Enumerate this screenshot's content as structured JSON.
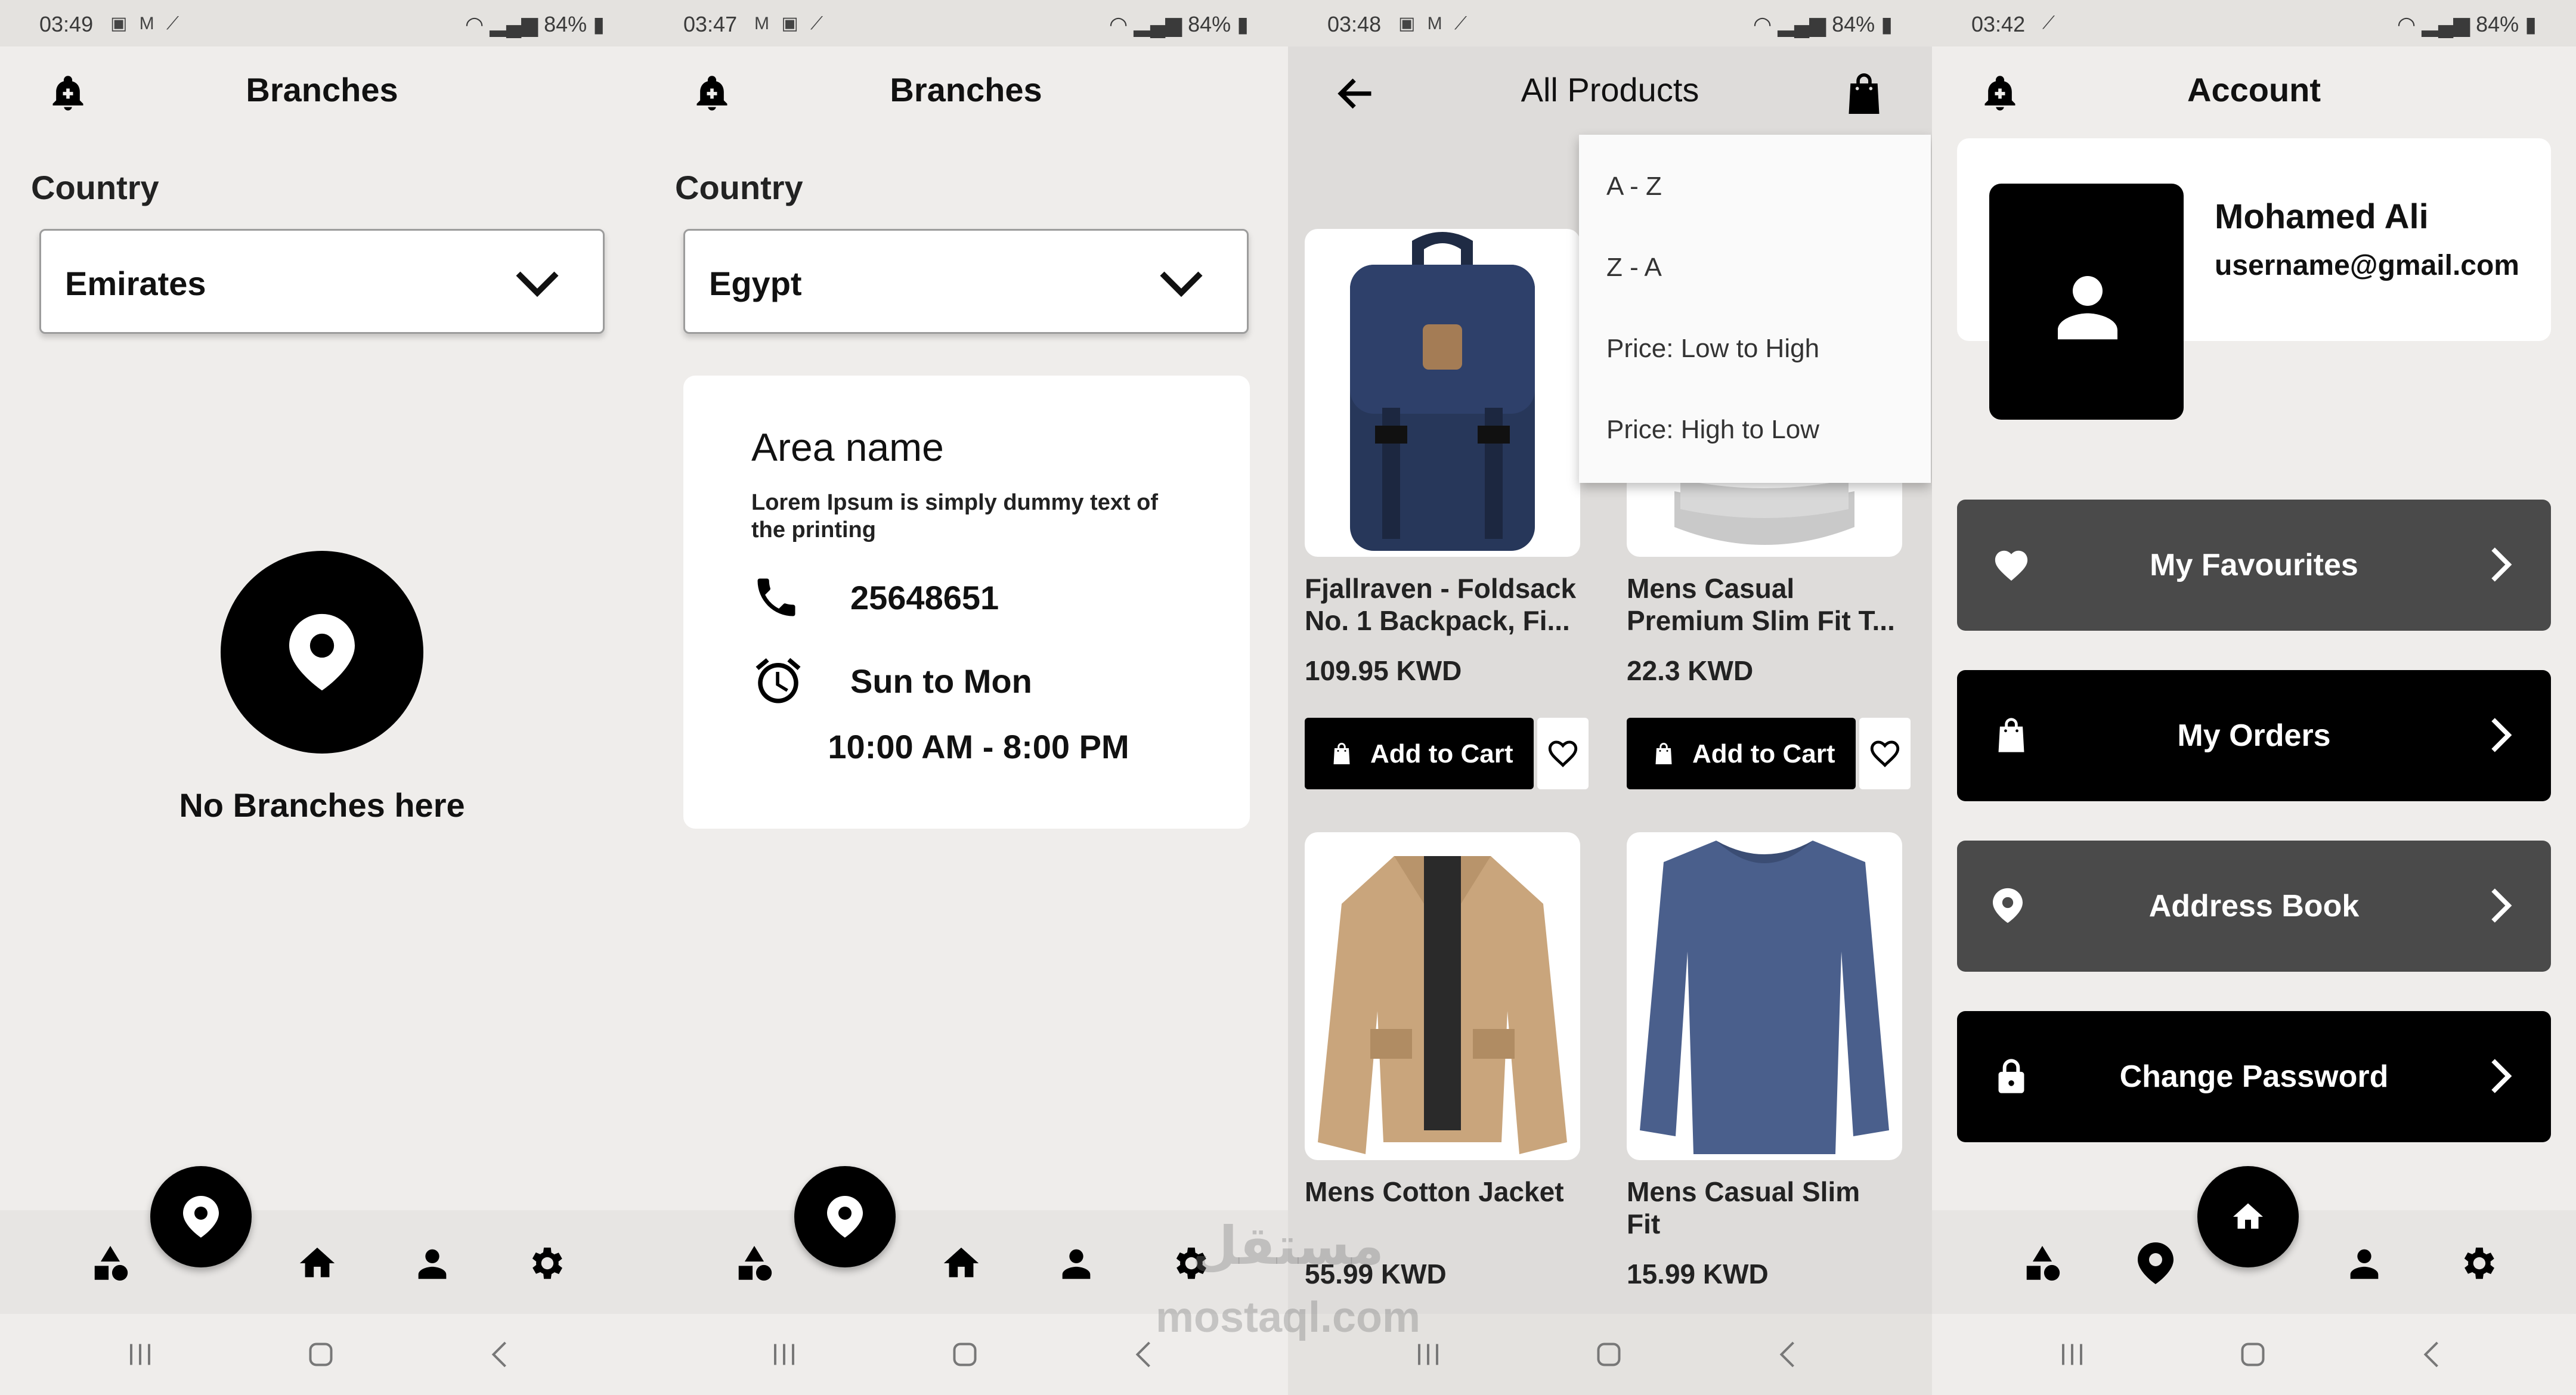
{
  "screens": {
    "branches_empty": {
      "status_time": "03:49",
      "battery": "84%",
      "title": "Branches",
      "country_label": "Country",
      "country_value": "Emirates",
      "empty_text": "No Branches here"
    },
    "branches_list": {
      "status_time": "03:47",
      "battery": "84%",
      "title": "Branches",
      "country_label": "Country",
      "country_value": "Egypt",
      "branch": {
        "area_name": "Area name",
        "description": "Lorem Ipsum is simply dummy text of the printing",
        "phone": "25648651",
        "days": "Sun to Mon",
        "hours": "10:00 AM - 8:00 PM"
      }
    },
    "products": {
      "status_time": "03:48",
      "battery": "84%",
      "title": "All Products",
      "sort_options": [
        "A - Z",
        "Z - A",
        "Price: Low to High",
        "Price: High to Low"
      ],
      "add_to_cart_label": "Add to Cart",
      "items": [
        {
          "name": "Fjallraven - Foldsack No. 1 Backpack, Fi...",
          "price": "109.95 KWD"
        },
        {
          "name": "Mens Casual Premium Slim Fit T...",
          "price": "22.3 KWD"
        },
        {
          "name": "Mens Cotton Jacket",
          "price": "55.99 KWD"
        },
        {
          "name": "Mens Casual Slim Fit",
          "price": "15.99 KWD"
        }
      ]
    },
    "account": {
      "status_time": "03:42",
      "battery": "84%",
      "title": "Account",
      "user_name": "Mohamed Ali",
      "user_email": "username@gmail.com",
      "menu": [
        {
          "label": "My Favourites",
          "icon": "heart-icon"
        },
        {
          "label": "My Orders",
          "icon": "bag-icon"
        },
        {
          "label": "Address Book",
          "icon": "location-pin-icon"
        },
        {
          "label": "Change Password",
          "icon": "lock-icon"
        }
      ]
    }
  },
  "watermark": {
    "arabic": "مستقل",
    "latin": "mostaql.com"
  },
  "colors": {
    "background": "#efedeb",
    "primary": "#000000",
    "secondary_button": "#4a4a4a",
    "card": "#ffffff"
  }
}
